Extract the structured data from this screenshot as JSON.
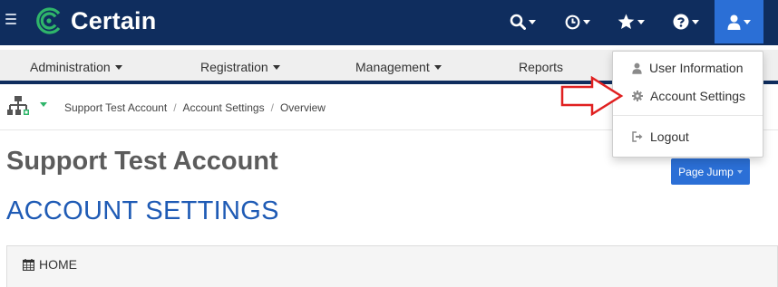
{
  "app": {
    "logo_text": "Certain",
    "brand_color": "#0f2d5e",
    "logo_color": "#2fb56a",
    "accent": "#2b6fd6"
  },
  "topbar": {
    "icons": [
      {
        "name": "search-icon"
      },
      {
        "name": "clock-icon"
      },
      {
        "name": "star-icon"
      },
      {
        "name": "help-icon"
      },
      {
        "name": "user-icon"
      }
    ]
  },
  "nav": {
    "items": [
      {
        "label": "Administration",
        "dropdown": true
      },
      {
        "label": "Registration",
        "dropdown": true
      },
      {
        "label": "Management",
        "dropdown": true
      },
      {
        "label": "Reports",
        "dropdown": false
      }
    ]
  },
  "breadcrumb": [
    "Support Test Account",
    "Account Settings",
    "Overview"
  ],
  "page": {
    "title": "Support Test Account",
    "subtitle": "ACCOUNT SETTINGS",
    "page_jump_label": "Page Jump"
  },
  "panel": {
    "heading": "HOME",
    "icon": "calendar-icon"
  },
  "user_menu": {
    "items": [
      {
        "label": "User Information",
        "icon": "user-icon"
      },
      {
        "label": "Account Settings",
        "icon": "gear-icon"
      },
      {
        "label": "Logout",
        "icon": "sign-out-icon"
      }
    ]
  },
  "annotation": {
    "arrow_color": "#e02020",
    "points_to": "Account Settings"
  }
}
